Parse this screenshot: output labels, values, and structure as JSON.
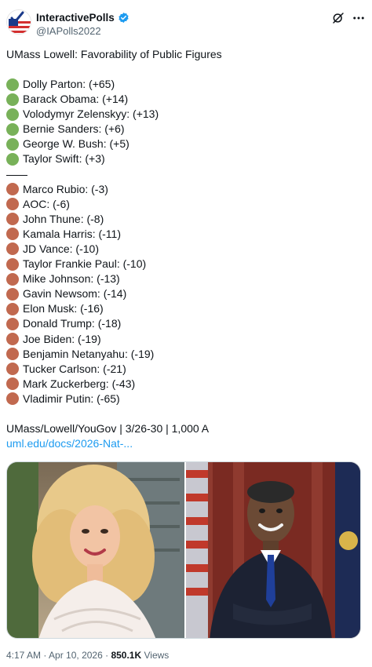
{
  "header": {
    "display_name": "InteractivePolls",
    "handle": "@IAPolls2022",
    "avatar_icon": "us-flag-check-icon",
    "verified_icon": "verified-badge-icon",
    "grok_icon": "grok-icon",
    "more_icon": "more-icon"
  },
  "tweet": {
    "title": "UMass Lowell: Favorability of Public Figures",
    "positive": [
      "Dolly Parton: (+65)",
      "Barack Obama: (+14)",
      "Volodymyr Zelenskyy: (+13)",
      "Bernie Sanders: (+6)",
      "George W. Bush: (+5)",
      "Taylor Swift: (+3)"
    ],
    "divider": "——",
    "negative": [
      "Marco Rubio: (-3)",
      "AOC: (-6)",
      "John Thune: (-8)",
      "Kamala Harris: (-11)",
      "JD Vance: (-10)",
      "Taylor Frankie Paul: (-10)",
      "Mike Johnson: (-13)",
      "Gavin Newsom: (-14)",
      "Elon Musk: (-16)",
      "Donald Trump: (-18)",
      "Joe Biden: (-19)",
      "Benjamin Netanyahu: (-19)",
      "Tucker Carlson: (-21)",
      "Mark Zuckerberg: (-43)",
      "Vladimir Putin: (-65)"
    ],
    "source": "UMass/Lowell/YouGov | 3/26-30 | 1,000 A",
    "link": "uml.edu/docs/2026-Nat-..."
  },
  "colors": {
    "green_dot": "#78b159",
    "brown_dot": "#c1694f",
    "link": "#1d9bf0",
    "verified": "#1d9bf0"
  },
  "meta": {
    "time": "4:17 AM",
    "separator": "·",
    "date": "Apr 10, 2026",
    "views_count": "850.1K",
    "views_label": "Views"
  }
}
